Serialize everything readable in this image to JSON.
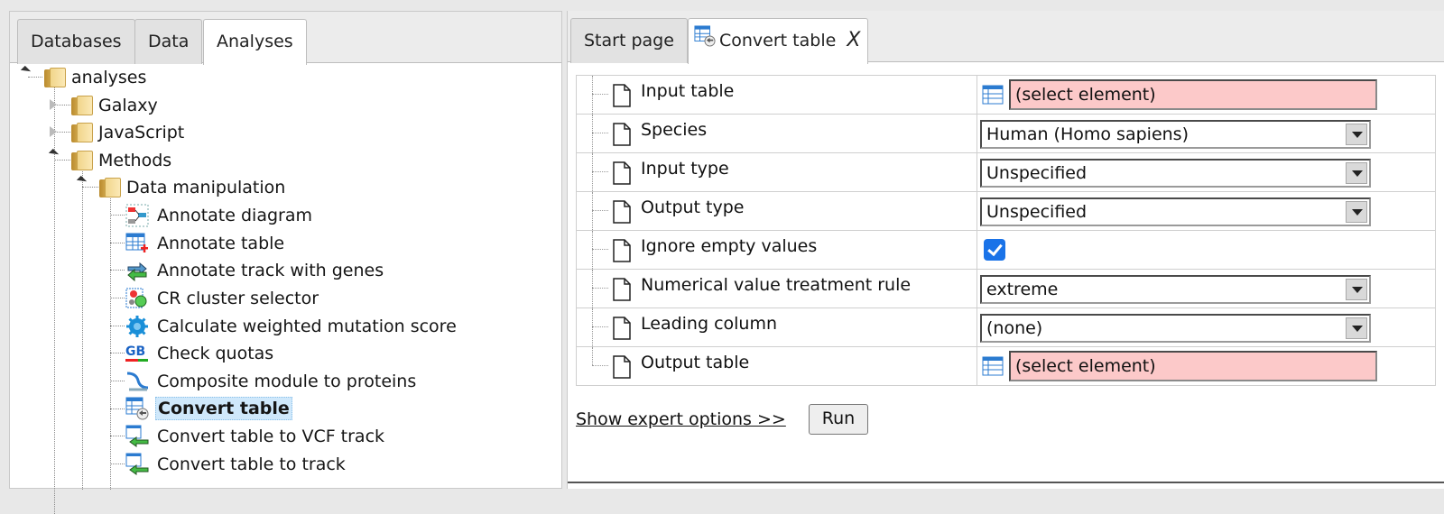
{
  "left_tabs": [
    "Databases",
    "Data",
    "Analyses"
  ],
  "left_active_tab": "Analyses",
  "tree": {
    "root": "analyses",
    "folders": [
      "Galaxy",
      "JavaScript",
      "Methods"
    ],
    "subfolder": "Data manipulation",
    "items": [
      {
        "label": "Annotate diagram",
        "icon": "annotate-diagram-icon"
      },
      {
        "label": "Annotate table",
        "icon": "annotate-table-icon"
      },
      {
        "label": "Annotate track with genes",
        "icon": "annotate-track-icon"
      },
      {
        "label": "CR cluster selector",
        "icon": "cluster-selector-icon"
      },
      {
        "label": "Calculate weighted mutation score",
        "icon": "gear-icon"
      },
      {
        "label": "Check quotas",
        "icon": "gb-quota-icon"
      },
      {
        "label": "Composite module to proteins",
        "icon": "composite-module-icon"
      },
      {
        "label": "Convert table",
        "icon": "convert-table-icon",
        "selected": true
      },
      {
        "label": "Convert table to VCF track",
        "icon": "convert-vcf-icon"
      },
      {
        "label": "Convert table to track",
        "icon": "convert-track-icon"
      }
    ]
  },
  "right_tabs": {
    "start_page": "Start page",
    "convert_table": "Convert table",
    "close": "X"
  },
  "params": [
    {
      "name": "Input table",
      "type": "element",
      "value": "(select element)"
    },
    {
      "name": "Species",
      "type": "select",
      "value": "Human (Homo sapiens)"
    },
    {
      "name": "Input type",
      "type": "select",
      "value": "Unspecified"
    },
    {
      "name": "Output type",
      "type": "select",
      "value": "Unspecified"
    },
    {
      "name": "Ignore empty values",
      "type": "checkbox",
      "checked": true
    },
    {
      "name": "Numerical value treatment rule",
      "type": "select",
      "value": "extreme"
    },
    {
      "name": "Leading column",
      "type": "select",
      "value": "(none)"
    },
    {
      "name": "Output table",
      "type": "element",
      "value": "(select element)"
    }
  ],
  "expert_link": "Show expert options >>",
  "run_label": "Run",
  "colors": {
    "missing_field": "#fcc9c9",
    "selection": "#cfe8fb",
    "checkbox": "#1a73e8"
  }
}
